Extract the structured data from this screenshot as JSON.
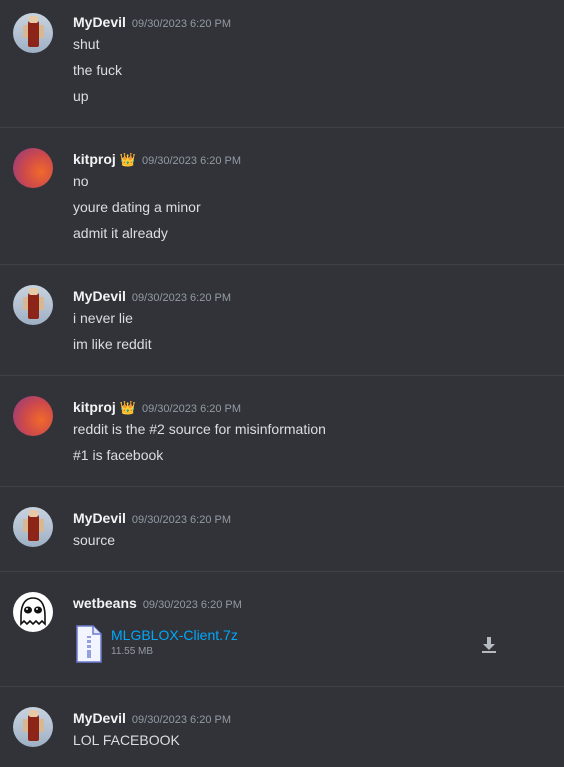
{
  "messages": [
    {
      "author": "MyDevil",
      "timestamp": "09/30/2023 6:20 PM",
      "lines": [
        "shut",
        "the fuck",
        "up"
      ]
    },
    {
      "author": "kitproj",
      "timestamp": "09/30/2023 6:20 PM",
      "lines": [
        "no",
        "youre dating a minor",
        "admit it already"
      ]
    },
    {
      "author": "MyDevil",
      "timestamp": "09/30/2023 6:20 PM",
      "lines": [
        "i never lie",
        "im like reddit"
      ]
    },
    {
      "author": "kitproj",
      "timestamp": "09/30/2023 6:20 PM",
      "lines": [
        "reddit is the #2 source for misinformation",
        "#1 is facebook"
      ]
    },
    {
      "author": "MyDevil",
      "timestamp": "09/30/2023 6:20 PM",
      "lines": [
        "source"
      ]
    },
    {
      "author": "wetbeans",
      "timestamp": "09/30/2023 6:20 PM",
      "attachment": {
        "name": "MLGBLOX-Client.7z",
        "size": "11.55 MB"
      }
    },
    {
      "author": "MyDevil",
      "timestamp": "09/30/2023 6:20 PM",
      "lines": [
        "LOL FACEBOOK"
      ]
    }
  ],
  "crown_icon": "👑",
  "colors": {
    "background": "#313338",
    "username": "#f2f3f5",
    "timestamp": "#949ba4",
    "link": "#00a8fc",
    "crown": "#f0b232"
  }
}
